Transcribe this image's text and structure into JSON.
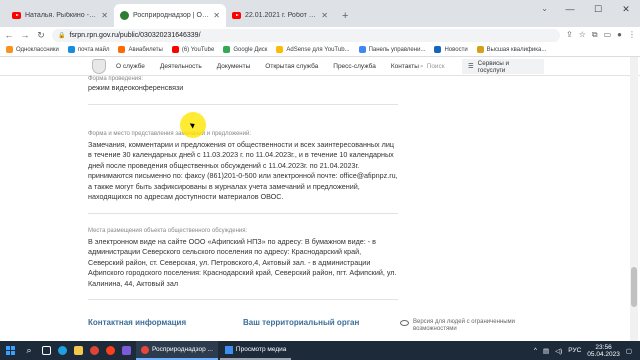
{
  "tabs": [
    {
      "title": "Наталья. Рыбкино - YouTube",
      "active": false,
      "favicon": "youtube"
    },
    {
      "title": "Росприроднадзор | Обществе...",
      "active": true,
      "favicon": "rpn"
    },
    {
      "title": "22.01.2021 г. Робот от Афипск...",
      "active": false,
      "favicon": "youtube"
    }
  ],
  "address": {
    "url": "fsrpn.rpn.gov.ru/public/030320231646339/"
  },
  "bookmarks": [
    {
      "label": "Одноклассники",
      "color": "#f7931e"
    },
    {
      "label": "почта майл",
      "color": "#168de2"
    },
    {
      "label": "Авиабилеты",
      "color": "#ff6a00"
    },
    {
      "label": "(6) YouTube",
      "color": "#ff0000"
    },
    {
      "label": "Google Диск",
      "color": "#34a853"
    },
    {
      "label": "AdSense для YouTub...",
      "color": "#fbbc05"
    },
    {
      "label": "Панель управлени...",
      "color": "#4285f4"
    },
    {
      "label": "Новости",
      "color": "#1565c0"
    },
    {
      "label": "Высшая квалифика...",
      "color": "#d4a017"
    }
  ],
  "site_nav": {
    "items": [
      "О службе",
      "Деятельность",
      "Документы",
      "Открытая служба",
      "Пресс-служба",
      "Контакты"
    ],
    "search_placeholder": "Поиск",
    "services": "Сервисы и госуслуги"
  },
  "sections": [
    {
      "label": "Форма проведения:",
      "text": "режим видеоконференсвязи"
    },
    {
      "label": "Форма и место представления замечаний и предложений:",
      "text": "Замечания, комментарии и предложения от общественности и всех заинтересованных лиц в течение 30 календарных дней с 11.03.2023 г. по 11.04.2023г., и в течение 10 календарных дней после проведения общественных обсуждений с 11.04.2023г. по 21.04.2023г. принимаются письменно по: факсу (861)201-0-500 или электронной почте: office@afipnpz.ru, а также могут быть зафиксированы в журналах учета замечаний и предложений, находящихся по адресам доступности материалов ОВОС."
    },
    {
      "label": "Места размещения объекта общественного обсуждения:",
      "text": "В электронном виде на сайте ООО «Афипский НПЗ» по адресу: В бумажном виде: - в администрации Северского сельского поселения по адресу: Краснодарский край, Северский район, ст. Северская, ул. Петровского,4, Актовый зал. - в администрации Афипского городского поселения: Краснодарский край, Северский район, пгт. Афипский, ул. Калинина, 44, Актовый зал"
    }
  ],
  "footer": {
    "contact": "Контактная информация",
    "territorial": "Ваш территориальный орган",
    "accessibility": "Версия для людей с ограниченными возможностями"
  },
  "taskbar": {
    "apps": [
      {
        "label": "Росприроднадзор ...",
        "color": "#e8453c"
      },
      {
        "label": "Просмотр медиа",
        "color": "#3d8ef0"
      }
    ],
    "lang": "РУС",
    "time": "23:56",
    "date": "05.04.2023"
  }
}
